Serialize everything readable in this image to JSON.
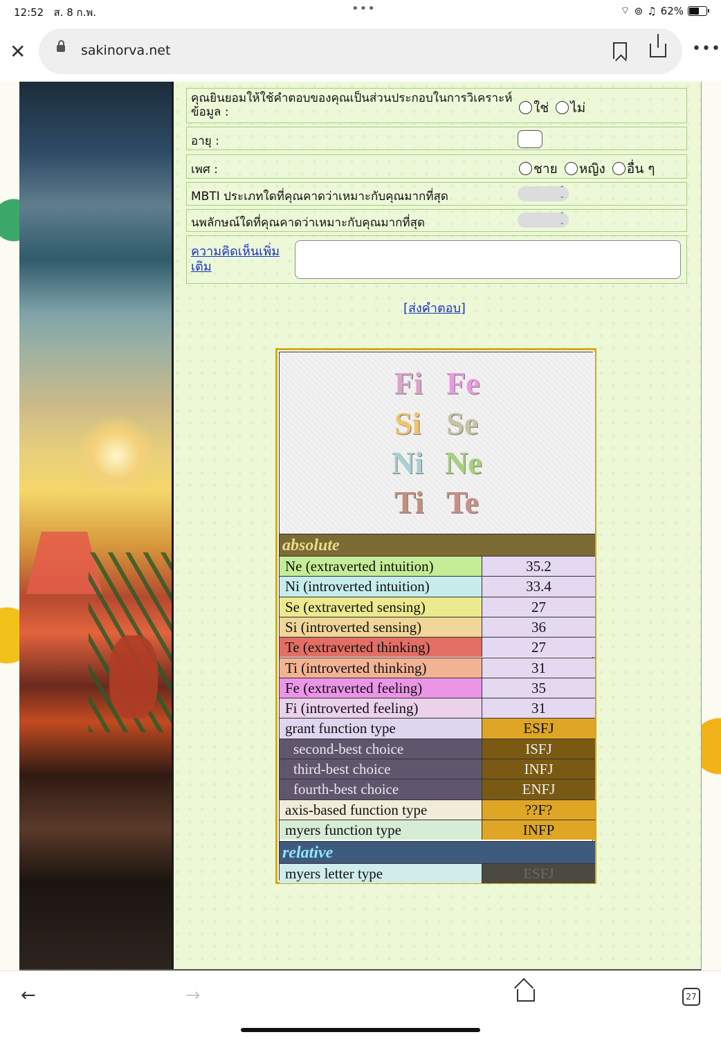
{
  "status_bar": {
    "time": "12:52",
    "date": "ส. 8 ก.พ.",
    "battery_label": "62%",
    "battery_level": 0.62
  },
  "browser": {
    "url": "sakinorva.net",
    "tab_count": "27"
  },
  "form": {
    "consent": {
      "label": "คุณยินยอมให้ใช้คำตอบของคุณเป็นส่วนประกอบในการวิเคราะห์ข้อมูล :",
      "options": [
        "ใช่",
        "ไม่"
      ]
    },
    "age": {
      "label": "อายุ :"
    },
    "gender": {
      "label": "เพศ :",
      "options": [
        "ชาย",
        "หญิง",
        "อื่น ๆ"
      ]
    },
    "mbti": {
      "label": "MBTI ประเภทใดที่คุณคาดว่าเหมาะกับคุณมากที่สุด"
    },
    "enneagram": {
      "label": "นพลักษณ์ใดที่คุณคาดว่าเหมาะกับคุณมากที่สุด"
    },
    "comment_link": "ความคิดเห็นเพิ่มเติม",
    "submit": "[ส่งคำตอบ]"
  },
  "functions_grid": [
    {
      "text": "Fi",
      "color": "#d9a5c9"
    },
    {
      "text": "Fe",
      "color": "#e79ae2"
    },
    {
      "text": "Si",
      "color": "#f0c46b"
    },
    {
      "text": "Se",
      "color": "#c8c2a6"
    },
    {
      "text": "Ni",
      "color": "#a8d0d0"
    },
    {
      "text": "Ne",
      "color": "#a5d27a"
    },
    {
      "text": "Ti",
      "color": "#c48f7b"
    },
    {
      "text": "Te",
      "color": "#c98f86"
    }
  ],
  "results": {
    "absolute_header": "absolute",
    "relative_header": "relative",
    "rows": [
      {
        "label": "Ne (extraverted intuition)",
        "value": "35.2",
        "label_bg": "#c5ec96",
        "value_bg": "#e4d9f0"
      },
      {
        "label": "Ni (introverted intuition)",
        "value": "33.4",
        "label_bg": "#c6ecec",
        "value_bg": "#e4d9f0"
      },
      {
        "label": "Se (extraverted sensing)",
        "value": "27",
        "label_bg": "#ecea8e",
        "value_bg": "#e4d9f0"
      },
      {
        "label": "Si (introverted sensing)",
        "value": "36",
        "label_bg": "#f0d699",
        "value_bg": "#e4d9f0"
      },
      {
        "label": "Te (extraverted thinking)",
        "value": "27",
        "label_bg": "#e36e64",
        "value_bg": "#e4d9f0"
      },
      {
        "label": "Ti (introverted thinking)",
        "value": "31",
        "label_bg": "#f2b394",
        "value_bg": "#e4d9f0"
      },
      {
        "label": "Fe (extraverted feeling)",
        "value": "35",
        "label_bg": "#ea95e6",
        "value_bg": "#e4d9f0"
      },
      {
        "label": "Fi (introverted feeling)",
        "value": "31",
        "label_bg": "#ebd1ea",
        "value_bg": "#e4d9f0"
      },
      {
        "label": "grant function type",
        "value": "ESFJ",
        "label_bg": "#ddd6ee",
        "value_bg": "#dea624"
      },
      {
        "label": "second-best choice",
        "value": "ISFJ",
        "label_bg": "#5f566e",
        "value_bg": "#7a5a12",
        "indent": true
      },
      {
        "label": "third-best choice",
        "value": "INFJ",
        "label_bg": "#5f566e",
        "value_bg": "#7a5a12",
        "indent": true
      },
      {
        "label": "fourth-best choice",
        "value": "ENFJ",
        "label_bg": "#5f566e",
        "value_bg": "#7a5a12",
        "indent": true
      },
      {
        "label": "axis-based function type",
        "value": "??F?",
        "label_bg": "#f0ecd8",
        "value_bg": "#dea624"
      },
      {
        "label": "myers function type",
        "value": "INFP",
        "label_bg": "#d6ecd6",
        "value_bg": "#dea624"
      }
    ],
    "relative_row": {
      "label": "myers letter type",
      "value": "ESFJ",
      "label_bg": "#d0ecec",
      "value_bg": "#4a4a42"
    }
  }
}
